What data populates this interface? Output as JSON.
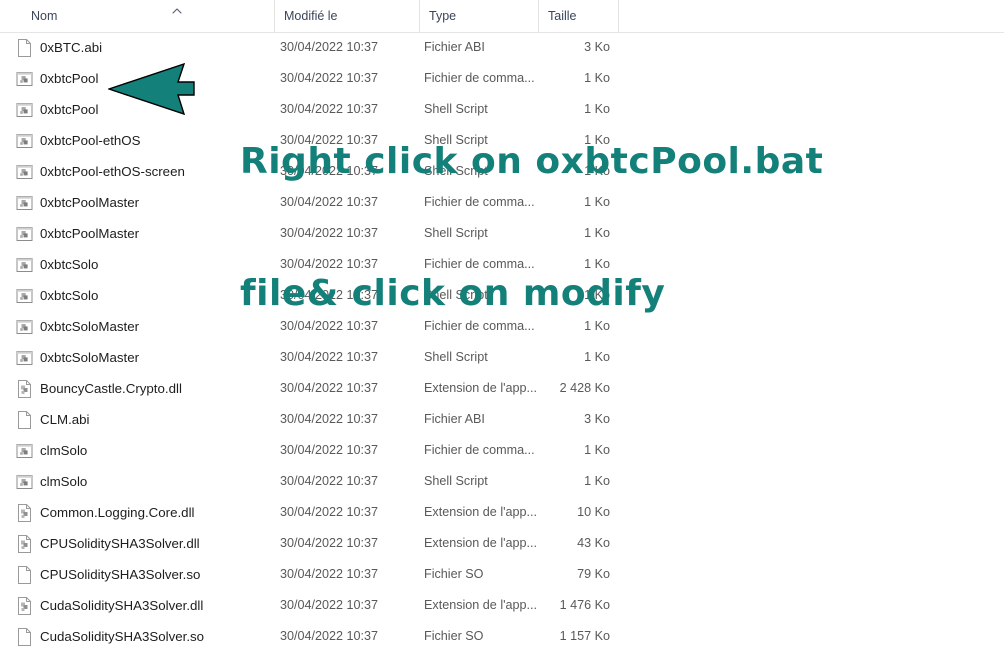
{
  "columns": {
    "name": "Nom",
    "modified": "Modifié le",
    "type": "Type",
    "size": "Taille",
    "sort_indicator": "˄"
  },
  "colors": {
    "annotation_teal": "#14807a",
    "header_text": "#3b4559",
    "row_text": "#1d1d1d",
    "secondary_text": "#595959"
  },
  "annotation": {
    "line1": "Right click on oxbtcPool.bat",
    "line2": "file& click on modify",
    "arrow_icon": "left-arrow-icon",
    "arrow_color": "#14807a"
  },
  "files": [
    {
      "name": "0xBTC.abi",
      "icon": "generic-file-icon",
      "modified": "30/04/2022 10:37",
      "type": "Fichier ABI",
      "size": "3 Ko"
    },
    {
      "name": "0xbtcPool",
      "icon": "batch-script-icon",
      "modified": "30/04/2022 10:37",
      "type": "Fichier de comma...",
      "size": "1 Ko"
    },
    {
      "name": "0xbtcPool",
      "icon": "batch-script-icon",
      "modified": "30/04/2022 10:37",
      "type": "Shell Script",
      "size": "1 Ko"
    },
    {
      "name": "0xbtcPool-ethOS",
      "icon": "batch-script-icon",
      "modified": "30/04/2022 10:37",
      "type": "Shell Script",
      "size": "1 Ko"
    },
    {
      "name": "0xbtcPool-ethOS-screen",
      "icon": "batch-script-icon",
      "modified": "30/04/2022 10:37",
      "type": "Shell Script",
      "size": "1 Ko"
    },
    {
      "name": "0xbtcPoolMaster",
      "icon": "batch-script-icon",
      "modified": "30/04/2022 10:37",
      "type": "Fichier de comma...",
      "size": "1 Ko"
    },
    {
      "name": "0xbtcPoolMaster",
      "icon": "batch-script-icon",
      "modified": "30/04/2022 10:37",
      "type": "Shell Script",
      "size": "1 Ko"
    },
    {
      "name": "0xbtcSolo",
      "icon": "batch-script-icon",
      "modified": "30/04/2022 10:37",
      "type": "Fichier de comma...",
      "size": "1 Ko"
    },
    {
      "name": "0xbtcSolo",
      "icon": "batch-script-icon",
      "modified": "30/04/2022 10:37",
      "type": "Shell Script",
      "size": "1 Ko"
    },
    {
      "name": "0xbtcSoloMaster",
      "icon": "batch-script-icon",
      "modified": "30/04/2022 10:37",
      "type": "Fichier de comma...",
      "size": "1 Ko"
    },
    {
      "name": "0xbtcSoloMaster",
      "icon": "batch-script-icon",
      "modified": "30/04/2022 10:37",
      "type": "Shell Script",
      "size": "1 Ko"
    },
    {
      "name": "BouncyCastle.Crypto.dll",
      "icon": "dll-file-icon",
      "modified": "30/04/2022 10:37",
      "type": "Extension de l'app...",
      "size": "2 428 Ko"
    },
    {
      "name": "CLM.abi",
      "icon": "generic-file-icon",
      "modified": "30/04/2022 10:37",
      "type": "Fichier ABI",
      "size": "3 Ko"
    },
    {
      "name": "clmSolo",
      "icon": "batch-script-icon",
      "modified": "30/04/2022 10:37",
      "type": "Fichier de comma...",
      "size": "1 Ko"
    },
    {
      "name": "clmSolo",
      "icon": "batch-script-icon",
      "modified": "30/04/2022 10:37",
      "type": "Shell Script",
      "size": "1 Ko"
    },
    {
      "name": "Common.Logging.Core.dll",
      "icon": "dll-file-icon",
      "modified": "30/04/2022 10:37",
      "type": "Extension de l'app...",
      "size": "10 Ko"
    },
    {
      "name": "CPUSoliditySHA3Solver.dll",
      "icon": "dll-file-icon",
      "modified": "30/04/2022 10:37",
      "type": "Extension de l'app...",
      "size": "43 Ko"
    },
    {
      "name": "CPUSoliditySHA3Solver.so",
      "icon": "generic-file-icon",
      "modified": "30/04/2022 10:37",
      "type": "Fichier SO",
      "size": "79 Ko"
    },
    {
      "name": "CudaSoliditySHA3Solver.dll",
      "icon": "dll-file-icon",
      "modified": "30/04/2022 10:37",
      "type": "Extension de l'app...",
      "size": "1 476 Ko"
    },
    {
      "name": "CudaSoliditySHA3Solver.so",
      "icon": "generic-file-icon",
      "modified": "30/04/2022 10:37",
      "type": "Fichier SO",
      "size": "1 157 Ko"
    }
  ]
}
